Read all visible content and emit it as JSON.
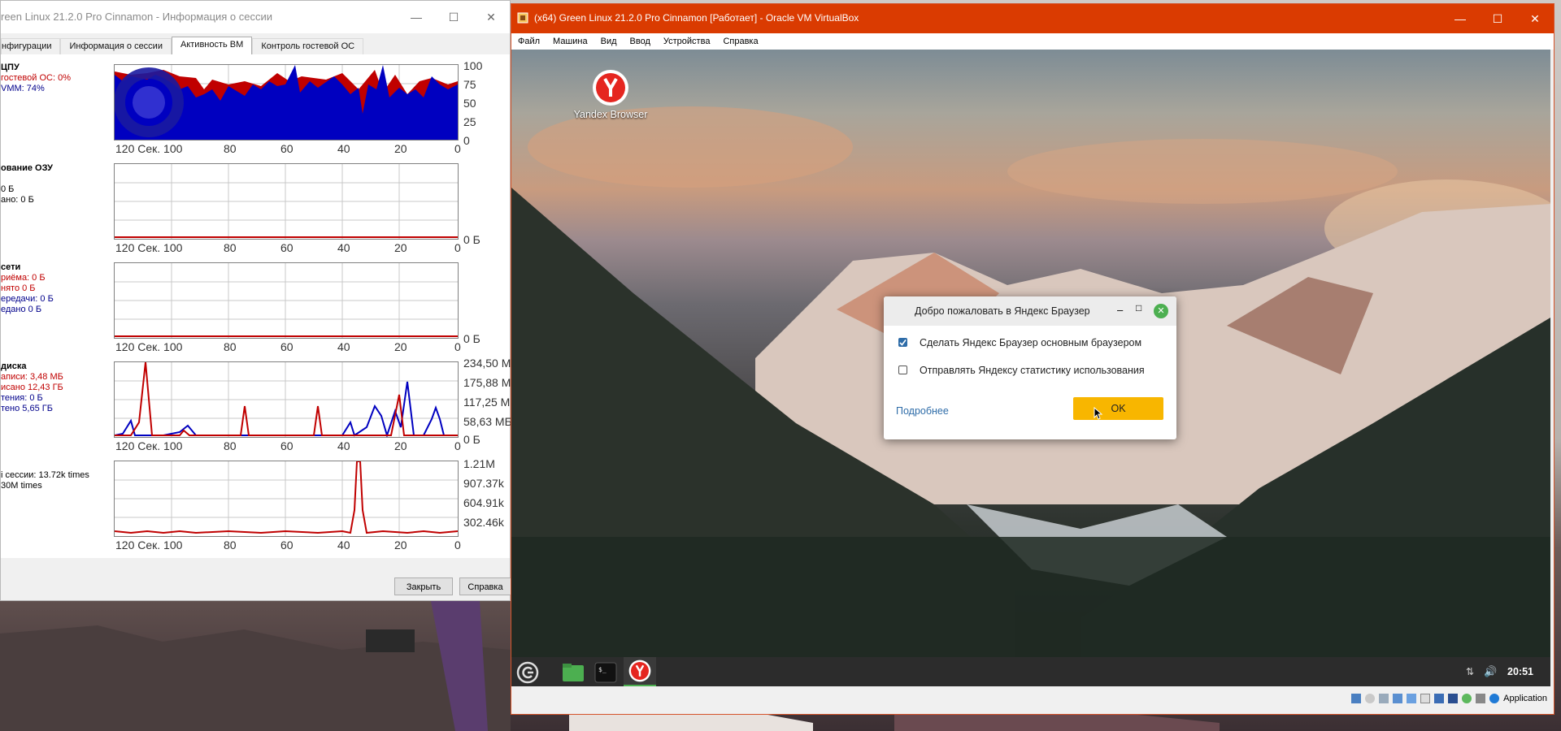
{
  "session_window": {
    "title": "reen Linux 21.2.0 Pro Cinnamon - Информация о сессии",
    "tabs": [
      {
        "label": "нфигурации",
        "active": false
      },
      {
        "label": "Информация о сессии",
        "active": false
      },
      {
        "label": "Активность ВМ",
        "active": true
      },
      {
        "label": "Контроль гостевой ОС",
        "active": false
      }
    ],
    "cpu": {
      "title": "ЦПУ",
      "guest": "гостевой ОС: 0%",
      "vmm": "VMM: 74%"
    },
    "ram": {
      "title": "ование ОЗУ",
      "line1": " 0 Б",
      "line2": "ано: 0 Б"
    },
    "net": {
      "title": "сети",
      "l1": "риёма: 0 Б",
      "l2": "нято 0 Б",
      "l3": "ередачи: 0 Б",
      "l4": "едано 0 Б"
    },
    "disk": {
      "title": "диска",
      "l1": "аписи: 3,48 МБ",
      "l2": "исано 12,43 ГБ",
      "l3": "тения: 0 Б",
      "l4": "тено 5,65 ГБ"
    },
    "exits": {
      "l1": "i сессии: 13.72k times",
      "l2": "30M times"
    },
    "x_axis": [
      "120 Сек. 100",
      "80",
      "60",
      "40",
      "20",
      "0"
    ],
    "cpu_y": [
      "100",
      "75",
      "50",
      "25",
      "0"
    ],
    "ram_y": "0 Б",
    "net_y": "0 Б",
    "disk_y": [
      "234,50 M",
      "175,88 M",
      "117,25 M",
      "58,63 МБ",
      "0 Б"
    ],
    "exits_y": [
      "1.21M",
      "907.37k",
      "604.91k",
      "302.46k"
    ],
    "close_btn": "Закрыть",
    "help_btn": "Справка"
  },
  "vbox": {
    "title": "(x64) Green Linux 21.2.0 Pro Cinnamon [Работает] - Oracle VM VirtualBox",
    "menu": [
      "Файл",
      "Машина",
      "Вид",
      "Ввод",
      "Устройства",
      "Справка"
    ],
    "status_label": "Application"
  },
  "guest": {
    "desktop_icon": "Yandex Browser",
    "dialog": {
      "title": "Добро пожаловать в Яндекс Браузер",
      "option1": "Сделать Яндекс Браузер основным браузером",
      "option1_checked": true,
      "option2": "Отправлять Яндексу статистику использования",
      "option2_checked": false,
      "more_link": "Подробнее",
      "ok": "OK"
    },
    "clock": "20:51"
  }
}
